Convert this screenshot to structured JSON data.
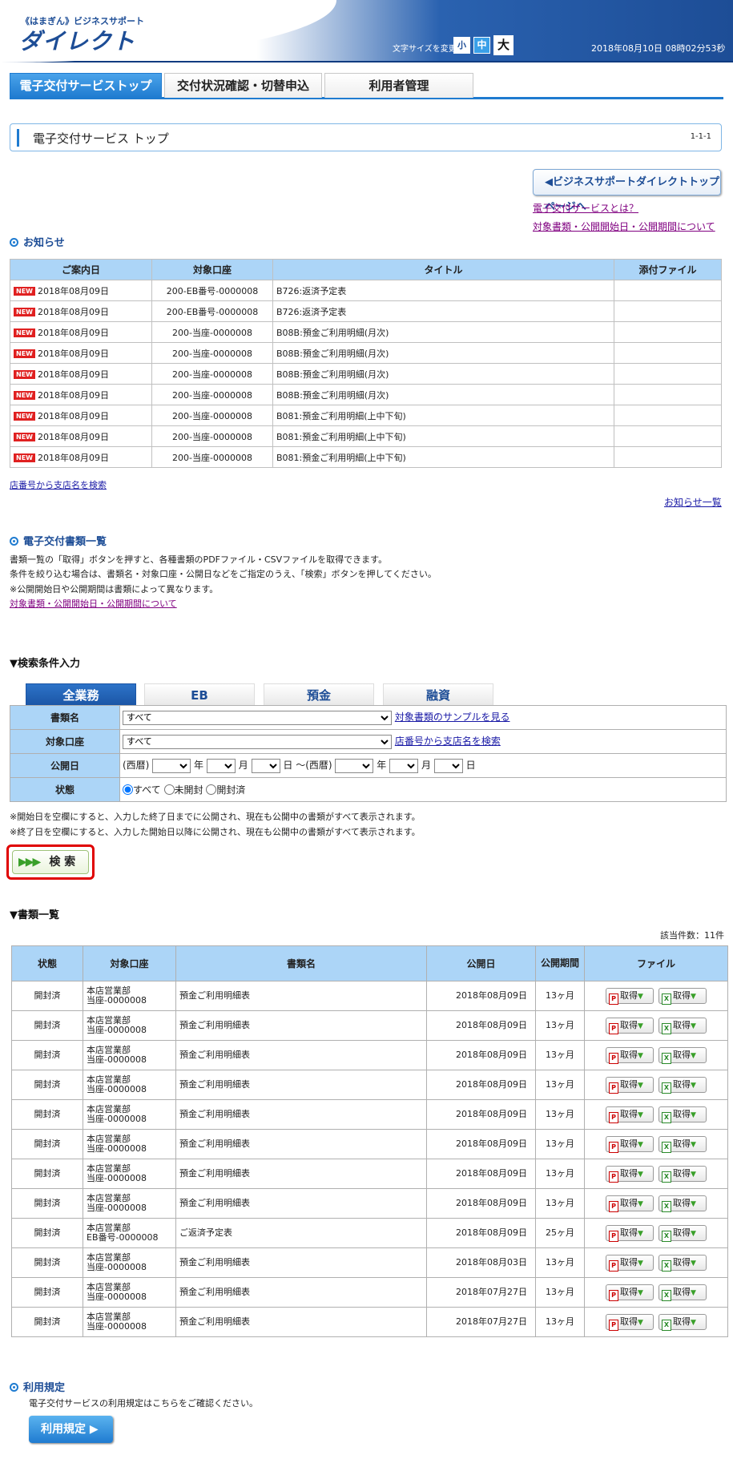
{
  "header": {
    "logo_small": "《はまぎん》ビジネスサポート",
    "logo_main": "ダイレクト",
    "font_size_label": "文字サイズを変更",
    "font_sizes": [
      "小",
      "中",
      "大"
    ],
    "datetime": "2018年08月10日 08時02分53秒"
  },
  "tabs": [
    "電子交付サービストップ",
    "交付状況確認・切替申込",
    "利用者管理"
  ],
  "page": {
    "title": "電子交付サービス トップ",
    "id": "1-1-1"
  },
  "top_links": {
    "bs_top": "ビジネスサポートダイレクトトップページへ",
    "what": "電子交付サービスとは？",
    "about_docs": "対象書類・公開開始日・公開期間について"
  },
  "notice": {
    "heading": "お知らせ",
    "columns": [
      "ご案内日",
      "対象口座",
      "タイトル",
      "添付ファイル"
    ],
    "new_label": "NEW",
    "rows": [
      [
        "2018年08月09日",
        "200-EB番号-0000008",
        "B726:返済予定表",
        ""
      ],
      [
        "2018年08月09日",
        "200-EB番号-0000008",
        "B726:返済予定表",
        ""
      ],
      [
        "2018年08月09日",
        "200-当座-0000008",
        "B08B:預金ご利用明細(月次)",
        ""
      ],
      [
        "2018年08月09日",
        "200-当座-0000008",
        "B08B:預金ご利用明細(月次)",
        ""
      ],
      [
        "2018年08月09日",
        "200-当座-0000008",
        "B08B:預金ご利用明細(月次)",
        ""
      ],
      [
        "2018年08月09日",
        "200-当座-0000008",
        "B08B:預金ご利用明細(月次)",
        ""
      ],
      [
        "2018年08月09日",
        "200-当座-0000008",
        "B081:預金ご利用明細(上中下旬)",
        ""
      ],
      [
        "2018年08月09日",
        "200-当座-0000008",
        "B081:預金ご利用明細(上中下旬)",
        ""
      ],
      [
        "2018年08月09日",
        "200-当座-0000008",
        "B081:預金ご利用明細(上中下旬)",
        ""
      ]
    ],
    "branch_search": "店番号から支店名を検索",
    "list_link": "お知らせ一覧"
  },
  "docs_section": {
    "heading": "電子交付書類一覧",
    "desc1": "書類一覧の「取得」ボタンを押すと、各種書類のPDFファイル・CSVファイルを取得できます。",
    "desc2": "条件を絞り込む場合は、書類名・対象口座・公開日などをご指定のうえ、「検索」ボタンを押してください。",
    "desc3": "※公開開始日や公開期間は書類によって異なります。",
    "link": "対象書類・公開開始日・公開期間について"
  },
  "search": {
    "heading": "検索条件入力",
    "tabs": [
      "全業務",
      "EB",
      "預金",
      "融資"
    ],
    "labels": {
      "doc": "書類名",
      "account": "対象口座",
      "date": "公開日",
      "status": "状態"
    },
    "doc_value": "すべて",
    "doc_sample": "対象書類のサンプルを見る",
    "account_value": "すべて",
    "branch_search": "店番号から支店名を検索",
    "era": "(西暦)",
    "year": "年",
    "month": "月",
    "day": "日",
    "tilde": "～",
    "era2": "(西暦)",
    "status_options": [
      "すべて",
      "未開封",
      "開封済"
    ],
    "note1": "※開始日を空欄にすると、入力した終了日までに公開され、現在も公開中の書類がすべて表示されます。",
    "note2": "※終了日を空欄にすると、入力した開始日以降に公開され、現在も公開中の書類がすべて表示されます。",
    "button": "検 索"
  },
  "docs_list": {
    "heading": "書類一覧",
    "count": "該当件数：11件",
    "columns": [
      "状態",
      "対象口座",
      "書類名",
      "公開日",
      "公開期間",
      "ファイル"
    ],
    "get_label": "取得",
    "rows": [
      [
        "開封済",
        "本店営業部",
        "当座-0000008",
        "預金ご利用明細表",
        "2018年08月09日",
        "13ヶ月"
      ],
      [
        "開封済",
        "本店営業部",
        "当座-0000008",
        "預金ご利用明細表",
        "2018年08月09日",
        "13ヶ月"
      ],
      [
        "開封済",
        "本店営業部",
        "当座-0000008",
        "預金ご利用明細表",
        "2018年08月09日",
        "13ヶ月"
      ],
      [
        "開封済",
        "本店営業部",
        "当座-0000008",
        "預金ご利用明細表",
        "2018年08月09日",
        "13ヶ月"
      ],
      [
        "開封済",
        "本店営業部",
        "当座-0000008",
        "預金ご利用明細表",
        "2018年08月09日",
        "13ヶ月"
      ],
      [
        "開封済",
        "本店営業部",
        "当座-0000008",
        "預金ご利用明細表",
        "2018年08月09日",
        "13ヶ月"
      ],
      [
        "開封済",
        "本店営業部",
        "当座-0000008",
        "預金ご利用明細表",
        "2018年08月09日",
        "13ヶ月"
      ],
      [
        "開封済",
        "本店営業部",
        "当座-0000008",
        "預金ご利用明細表",
        "2018年08月09日",
        "13ヶ月"
      ],
      [
        "開封済",
        "本店営業部",
        "EB番号-0000008",
        "ご返済予定表",
        "2018年08月09日",
        "25ヶ月"
      ],
      [
        "開封済",
        "本店営業部",
        "当座-0000008",
        "預金ご利用明細表",
        "2018年08月03日",
        "13ヶ月"
      ],
      [
        "開封済",
        "本店営業部",
        "当座-0000008",
        "預金ご利用明細表",
        "2018年07月27日",
        "13ヶ月"
      ],
      [
        "開封済",
        "本店営業部",
        "当座-0000008",
        "預金ご利用明細表",
        "2018年07月27日",
        "13ヶ月"
      ]
    ]
  },
  "terms": {
    "heading": "利用規定",
    "desc": "電子交付サービスの利用規定はこちらをご確認ください。",
    "button": "利用規定"
  }
}
